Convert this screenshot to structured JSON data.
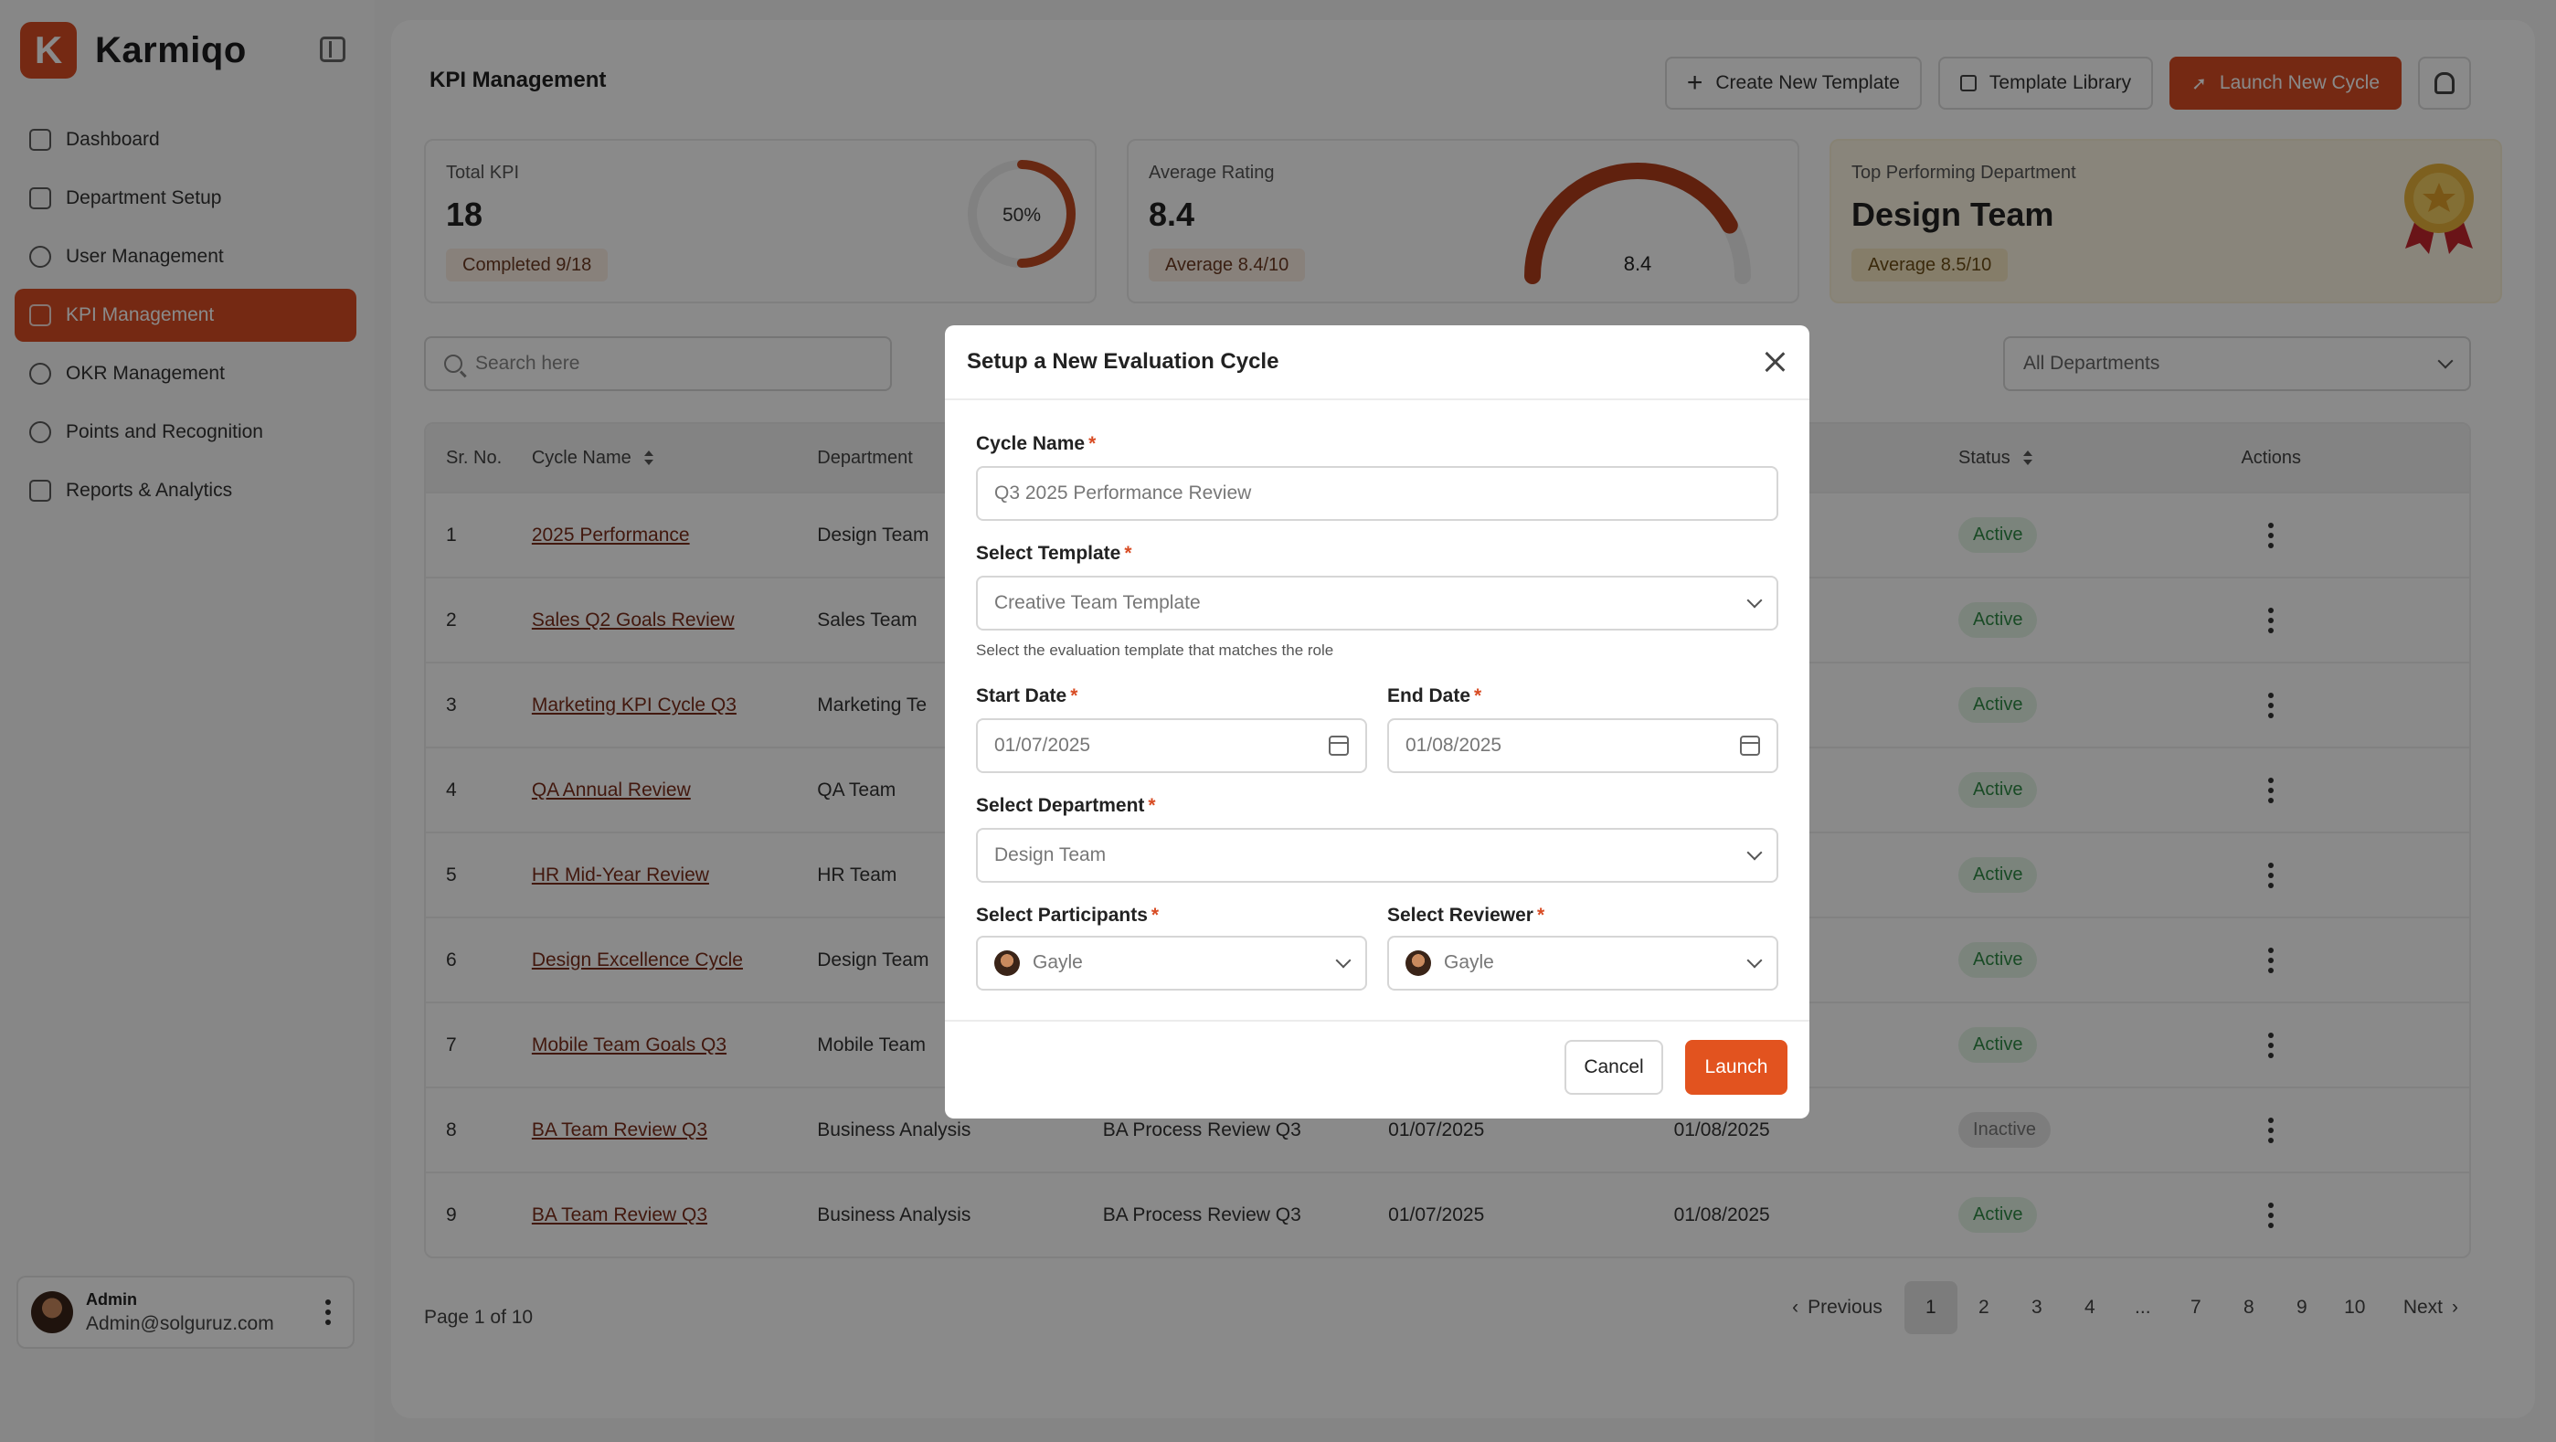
{
  "brand": {
    "name": "Karmiqo",
    "logo_letter": "K",
    "accent": "#d84c24"
  },
  "sidebar": {
    "items": [
      {
        "label": "Dashboard",
        "icon": "home-icon"
      },
      {
        "label": "Department Setup",
        "icon": "hierarchy-icon"
      },
      {
        "label": "User Management",
        "icon": "users-icon"
      },
      {
        "label": "KPI Management",
        "icon": "chart-icon",
        "active": true
      },
      {
        "label": "OKR Management",
        "icon": "target-icon"
      },
      {
        "label": "Points and Recognition",
        "icon": "award-icon"
      },
      {
        "label": "Reports & Analytics",
        "icon": "report-icon"
      }
    ],
    "user": {
      "role": "Admin",
      "email": "Admin@solguruz.com"
    }
  },
  "header": {
    "title": "KPI Management",
    "create_template": "Create New Template",
    "template_library": "Template Library",
    "launch_cycle": "Launch New Cycle"
  },
  "stats": {
    "total_kpi": {
      "label": "Total KPI",
      "value": "18",
      "pill": "Completed 9/18",
      "ring_text": "50%",
      "ring_fraction": 0.5
    },
    "avg_rating": {
      "label": "Average Rating",
      "value": "8.4",
      "pill": "Average 8.4/10",
      "gauge_text": "8.4",
      "gauge_fraction": 0.84
    },
    "top_dept": {
      "label": "Top Performing Department",
      "value": "Design Team",
      "pill": "Average 8.5/10"
    }
  },
  "search": {
    "placeholder": "Search here"
  },
  "filter": {
    "selected": "All Departments"
  },
  "table": {
    "headers": {
      "sr": "Sr. No.",
      "cycle": "Cycle Name",
      "dept": "Department",
      "status": "Status",
      "actions": "Actions"
    },
    "rows": [
      {
        "sr": "1",
        "cycle": "2025 Performance",
        "dept": "Design Team",
        "template": "",
        "start": "",
        "end": "",
        "status": "Active"
      },
      {
        "sr": "2",
        "cycle": "Sales Q2 Goals Review",
        "dept": "Sales Team",
        "template": "",
        "start": "",
        "end": "",
        "status": "Active"
      },
      {
        "sr": "3",
        "cycle": "Marketing KPI Cycle Q3",
        "dept": "Marketing Te",
        "template": "",
        "start": "",
        "end": "",
        "status": "Active"
      },
      {
        "sr": "4",
        "cycle": "QA Annual Review",
        "dept": "QA Team",
        "template": "",
        "start": "",
        "end": "",
        "status": "Active"
      },
      {
        "sr": "5",
        "cycle": "HR Mid-Year Review",
        "dept": "HR Team",
        "template": "",
        "start": "",
        "end": "",
        "status": "Active"
      },
      {
        "sr": "6",
        "cycle": "Design Excellence Cycle",
        "dept": "Design Team",
        "template": "",
        "start": "",
        "end": "",
        "status": "Active"
      },
      {
        "sr": "7",
        "cycle": "Mobile Team Goals Q3",
        "dept": "Mobile Team",
        "template": "",
        "start": "",
        "end": "",
        "status": "Active"
      },
      {
        "sr": "8",
        "cycle": "BA Team Review Q3",
        "dept": "Business Analysis",
        "template": "BA Process Review Q3",
        "start": "01/07/2025",
        "end": "01/08/2025",
        "status": "Inactive"
      },
      {
        "sr": "9",
        "cycle": "BA Team Review Q3",
        "dept": "Business Analysis",
        "template": "BA Process Review Q3",
        "start": "01/07/2025",
        "end": "01/08/2025",
        "status": "Active"
      }
    ]
  },
  "pagination": {
    "info": "Page 1 of 10",
    "previous": "Previous",
    "next": "Next",
    "pages": [
      "1",
      "2",
      "3",
      "4",
      "...",
      "7",
      "8",
      "9",
      "10"
    ],
    "current": "1"
  },
  "modal": {
    "title": "Setup a New Evaluation Cycle",
    "cycle_name": {
      "label": "Cycle Name",
      "placeholder": "Q3 2025 Performance Review"
    },
    "template": {
      "label": "Select Template",
      "value": "Creative Team Template",
      "hint": "Select the evaluation template that matches the role"
    },
    "start_date": {
      "label": "Start Date",
      "value": "01/07/2025"
    },
    "end_date": {
      "label": "End Date",
      "value": "01/08/2025"
    },
    "department": {
      "label": "Select Department",
      "value": "Design Team"
    },
    "participants": {
      "label": "Select Participants",
      "value": "Gayle"
    },
    "reviewer": {
      "label": "Select Reviewer",
      "value": "Gayle"
    },
    "required_mark": "*",
    "cancel": "Cancel",
    "launch": "Launch"
  }
}
